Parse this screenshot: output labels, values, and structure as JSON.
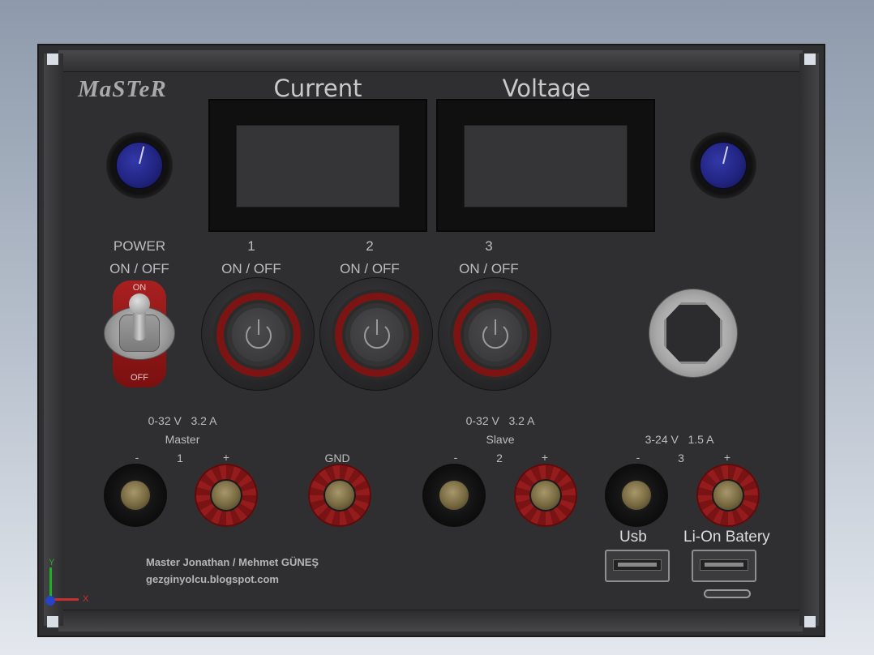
{
  "panel": {
    "brand": "MaSTeR",
    "displays": [
      {
        "title": "Current"
      },
      {
        "title": "Voltage"
      }
    ],
    "power": {
      "line1": "POWER",
      "line2": "ON / OFF",
      "toggle_on": "ON",
      "toggle_off": "OFF"
    },
    "switches": [
      {
        "number": "1",
        "label": "ON / OFF"
      },
      {
        "number": "2",
        "label": "ON / OFF"
      },
      {
        "number": "3",
        "label": "ON / OFF"
      }
    ],
    "outputs": {
      "master": {
        "spec_v": "0-32 V",
        "spec_a": "3.2 A",
        "name": "Master",
        "minus": "-",
        "number": "1",
        "plus": "+"
      },
      "gnd": {
        "label": "GND"
      },
      "slave": {
        "spec_v": "0-32 V",
        "spec_a": "3.2 A",
        "name": "Slave",
        "minus": "-",
        "number": "2",
        "plus": "+"
      },
      "third": {
        "spec_v": "3-24 V",
        "spec_a": "1.5 A",
        "minus": "-",
        "number": "3",
        "plus": "+"
      }
    },
    "usb": {
      "label": "Usb"
    },
    "battery": {
      "label": "Li-On Batery"
    },
    "footer": {
      "author": "Master Jonathan / Mehmet GÜNEŞ",
      "website": "gezginyolcu.blogspot.com"
    }
  },
  "axes": {
    "x_label": "X",
    "y_label": "Y"
  },
  "colors": {
    "panel": "#2f2f31",
    "knob": "#20237e",
    "button_ring": "#7d1414",
    "terminal_red": "#951c1c"
  }
}
